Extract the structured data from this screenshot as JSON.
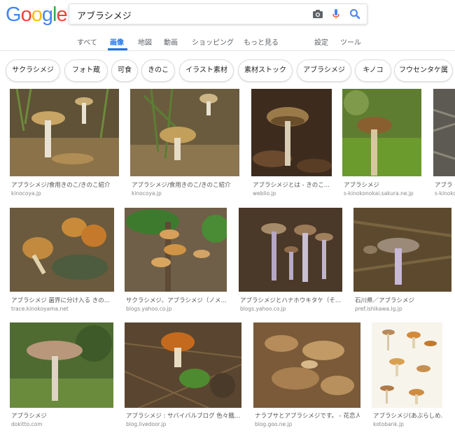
{
  "logo": {
    "letters": [
      "G",
      "o",
      "o",
      "g",
      "l",
      "e"
    ],
    "colors": [
      "#4285F4",
      "#EA4335",
      "#FBBC05",
      "#4285F4",
      "#34A853",
      "#EA4335"
    ]
  },
  "search": {
    "query": "アブラシメジ"
  },
  "icons": {
    "camera": "camera-icon",
    "mic": "microphone-icon",
    "search": "search-icon"
  },
  "tabs": [
    "すべて",
    "画像",
    "地図",
    "動画",
    "ショッピング",
    "もっと見る",
    "設定",
    "ツール"
  ],
  "active_tab": "画像",
  "chips": [
    "サクラシメジ",
    "フォト蔵",
    "可食",
    "きのこ",
    "イラスト素材",
    "素材ストック",
    "アブラシメジ",
    "キノコ",
    "フウセンタケ属"
  ],
  "results": [
    {
      "caption": "アブラシメジ/食用きのこ/きのこ紹介",
      "source": "kinocoya.jp"
    },
    {
      "caption": "アブラシメジ/食用きのこ/きのこ紹介",
      "source": "kinocoya.jp"
    },
    {
      "caption": "アブラシメジとは - きのこ...",
      "source": "weblio.jp"
    },
    {
      "caption": "アブラシメジ",
      "source": "s-kinokonokai.sakura.ne.jp"
    },
    {
      "caption": "アブラ",
      "source": "s-kinoko"
    },
    {
      "caption": "アブラシメジ 菌界に分け入る きの...",
      "source": "trace.kinokoyama.net"
    },
    {
      "caption": "サクラシメジ、アブラシメジ（ノメ...",
      "source": "blogs.yahoo.co.jp"
    },
    {
      "caption": "アブラシメジとハナホウキタケ（そ...",
      "source": "blogs.yahoo.co.jp"
    },
    {
      "caption": "石川県／アブラシメジ",
      "source": "pref.ishikawa.lg.jp"
    },
    {
      "caption": "アブラシメジ",
      "source": "dokitto.com"
    },
    {
      "caption": "アブラシメジ : サバイバルブログ 色々餓...",
      "source": "blog.livedoor.jp"
    },
    {
      "caption": "ナラブサとアブラシメジです。 - 花恋人",
      "source": "blog.goo.ne.jp"
    },
    {
      "caption": "アブラシメジ(あぶらしめ...",
      "source": "kotobank.jp"
    }
  ]
}
